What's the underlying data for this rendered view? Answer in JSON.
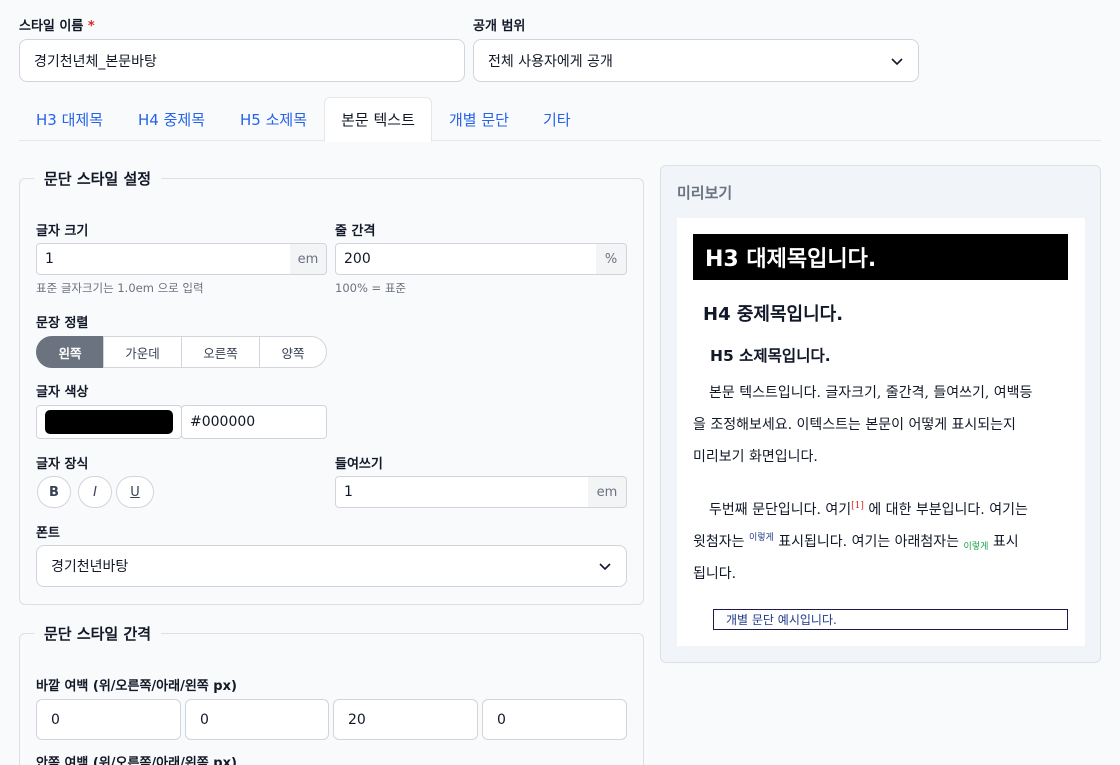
{
  "form": {
    "style_name_label": "스타일 이름",
    "required_mark": "*",
    "style_name_value": "경기천년체_본문바탕",
    "visibility_label": "공개 범위",
    "visibility_value": "전체 사용자에게 공개"
  },
  "tabs": [
    {
      "label": "H3 대제목"
    },
    {
      "label": "H4 중제목"
    },
    {
      "label": "H5 소제목"
    },
    {
      "label": "본문 텍스트",
      "active": true
    },
    {
      "label": "개별 문단"
    },
    {
      "label": "기타"
    }
  ],
  "paragraph_style": {
    "legend": "문단 스타일 설정",
    "font_size_label": "글자 크기",
    "font_size_value": "1",
    "font_size_unit": "em",
    "font_size_hint": "표준 글자크기는 1.0em 으로 입력",
    "line_height_label": "줄 간격",
    "line_height_value": "200",
    "line_height_unit": "%",
    "line_height_hint": "100% = 표준",
    "align_label": "문장 정렬",
    "align_options": [
      "왼쪽",
      "가운데",
      "오른쪽",
      "양쪽"
    ],
    "color_label": "글자 색상",
    "color_value": "#000000",
    "decoration_label": "글자 장식",
    "decoration_buttons": [
      "B",
      "I",
      "U"
    ],
    "indent_label": "들여쓰기",
    "indent_value": "1",
    "indent_unit": "em",
    "font_label": "폰트",
    "font_value": "경기천년바탕"
  },
  "spacing": {
    "legend": "문단 스타일 간격",
    "margin_label": "바깥 여백 (위/오른쪽/아래/왼쪽 px)",
    "margin_values": [
      "0",
      "0",
      "20",
      "0"
    ],
    "padding_label": "안쪽 여백 (위/오른쪽/아래/왼쪽 px)"
  },
  "preview": {
    "title": "미리보기",
    "h3": "H3 대제목입니다.",
    "h4": "H4 중제목입니다.",
    "h5": "H5 소제목입니다.",
    "p1_line1": "본문 텍스트입니다. 글자크기, 줄간격, 들여쓰기, 여백등",
    "p1_line2": "을 조정해보세요. 이텍스트는 본문이 어떻게 표시되는지",
    "p1_line3": "미리보기 화면입니다.",
    "p2_a": "두번째 문단입니다. 여기",
    "p2_sup": "[1]",
    "p2_b": " 에 대한 부분입니다. 여기는",
    "p2_c": "윗첨자는 ",
    "p2_sup_word": "이렇게",
    "p2_d": " 표시됩니다. 여기는 아래첨자는 ",
    "p2_sub_word": "이렇게",
    "p2_e": " 표시",
    "p2_line3": "됩니다.",
    "individual": "개별 문단 예시입니다."
  },
  "colors": {
    "accent": "#2563eb",
    "sup_ref": "#dc2626",
    "sup_word": "#1e3a8a",
    "sub_word": "#16a34a",
    "individual_border": "#1e1b4b"
  }
}
